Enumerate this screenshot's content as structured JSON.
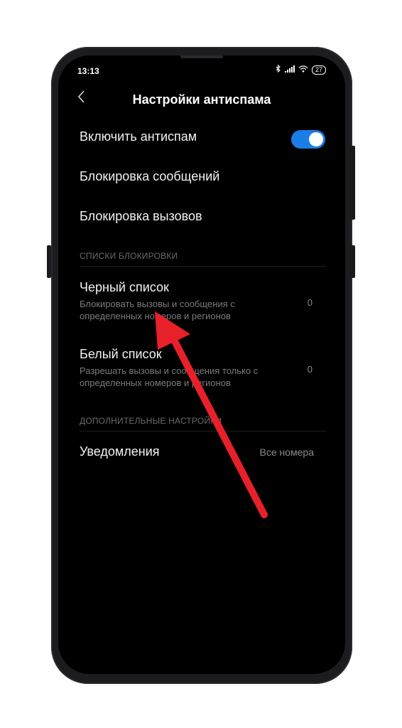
{
  "status_bar": {
    "time": "13:13",
    "signal": "..ıl",
    "battery": "27"
  },
  "header": {
    "back_icon": "chevron-left-icon",
    "title": "Настройки антиспама"
  },
  "settings": {
    "enable_antispam": {
      "label": "Включить антиспам",
      "enabled": true
    },
    "block_messages": {
      "label": "Блокировка сообщений"
    },
    "block_calls": {
      "label": "Блокировка вызовов"
    }
  },
  "block_lists": {
    "section_title": "СПИСКИ БЛОКИРОВКИ",
    "blacklist": {
      "title": "Черный список",
      "subtitle": "Блокировать вызовы и сообщения с определенных номеров и регионов",
      "count": "0"
    },
    "whitelist": {
      "title": "Белый список",
      "subtitle": "Разрешать вызовы и сообщения только с определенных номеров и регионов",
      "count": "0"
    }
  },
  "additional": {
    "section_title": "ДОПОЛНИТЕЛЬНЫЕ НАСТРОЙКИ",
    "notifications": {
      "label": "Уведомления",
      "value": "Все номера"
    }
  },
  "colors": {
    "accent": "#1b7de6",
    "annotation_arrow": "#e8202a",
    "screen_bg": "#000000"
  }
}
